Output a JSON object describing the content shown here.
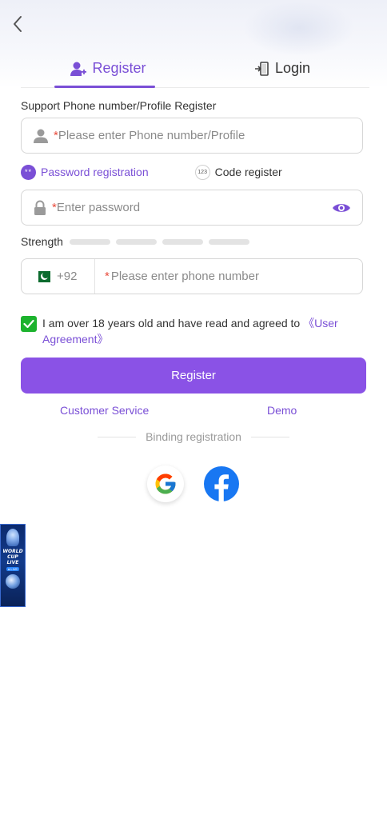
{
  "header": {
    "tabs": [
      {
        "label": "Register",
        "active": true,
        "icon": "add-user-icon"
      },
      {
        "label": "Login",
        "active": false,
        "icon": "login-door-icon"
      }
    ]
  },
  "form": {
    "section_label": "Support Phone number/Profile Register",
    "account_field": {
      "required_mark": "*",
      "placeholder": "Please enter Phone number/Profile",
      "icon": "user-icon"
    },
    "modes": {
      "password": {
        "badge": "**",
        "label": "Password registration",
        "selected": true
      },
      "code": {
        "badge": "123",
        "label": "Code register",
        "selected": false
      }
    },
    "password_field": {
      "required_mark": "*",
      "placeholder": "Enter password",
      "icon": "lock-icon",
      "toggle_icon": "eye-icon"
    },
    "strength": {
      "label": "Strength",
      "segments": 4,
      "filled": 0
    },
    "phone_field": {
      "country_code": "+92",
      "country_flag": "pakistan-flag-icon",
      "required_mark": "*",
      "placeholder": "Please enter phone number"
    },
    "agreement": {
      "checked": true,
      "text": "I am over 18 years old and have read and agreed to ",
      "link": "《User Agreement》"
    },
    "submit_label": "Register"
  },
  "links": {
    "customer_service": "Customer Service",
    "demo": "Demo"
  },
  "binding": {
    "label": "Binding registration",
    "providers": [
      "google",
      "facebook"
    ]
  },
  "banner": {
    "line1": "WORLD",
    "line2": "CUP",
    "line3": "LIVE",
    "pill": "● LIVE"
  },
  "colors": {
    "accent": "#7a4fd6",
    "button": "#8a52e6",
    "checkbox": "#1db32e",
    "required": "#e84b3c"
  }
}
